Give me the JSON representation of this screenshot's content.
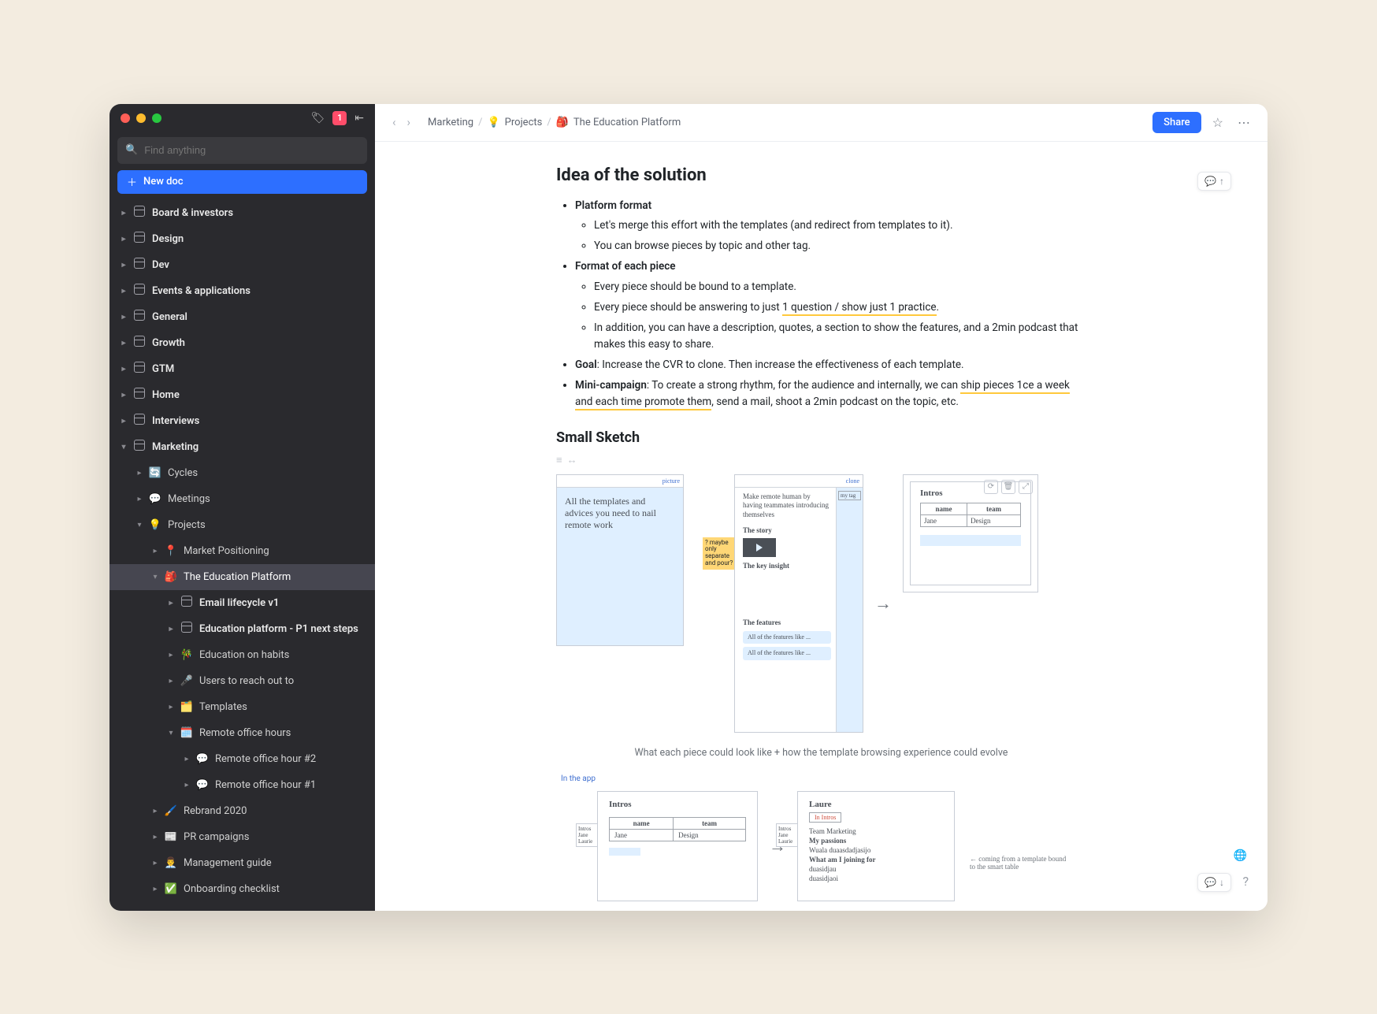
{
  "titlebar": {
    "notif_count": "1"
  },
  "search": {
    "placeholder": "Find anything"
  },
  "new_doc_label": "New doc",
  "sidebar": {
    "items": [
      {
        "label": "Board & investors",
        "indent": 0,
        "icon": "doc",
        "bold": true
      },
      {
        "label": "Design",
        "indent": 0,
        "icon": "doc",
        "bold": true
      },
      {
        "label": "Dev",
        "indent": 0,
        "icon": "doc",
        "bold": true
      },
      {
        "label": "Events & applications",
        "indent": 0,
        "icon": "doc",
        "bold": true
      },
      {
        "label": "General",
        "indent": 0,
        "icon": "doc",
        "bold": true
      },
      {
        "label": "Growth",
        "indent": 0,
        "icon": "doc",
        "bold": true
      },
      {
        "label": "GTM",
        "indent": 0,
        "icon": "doc",
        "bold": true
      },
      {
        "label": "Home",
        "indent": 0,
        "icon": "doc",
        "bold": true
      },
      {
        "label": "Interviews",
        "indent": 0,
        "icon": "doc",
        "bold": true
      },
      {
        "label": "Marketing",
        "indent": 0,
        "icon": "doc",
        "bold": true,
        "open": true
      },
      {
        "label": "Cycles",
        "indent": 1,
        "icon": "🔄"
      },
      {
        "label": "Meetings",
        "indent": 1,
        "icon": "💬"
      },
      {
        "label": "Projects",
        "indent": 1,
        "icon": "💡",
        "open": true
      },
      {
        "label": "Market Positioning",
        "indent": 2,
        "icon": "📍"
      },
      {
        "label": "The Education Platform",
        "indent": 2,
        "icon": "🎒",
        "selected": true,
        "open": true
      },
      {
        "label": "Email lifecycle v1",
        "indent": 3,
        "icon": "doc",
        "bold": true
      },
      {
        "label": "Education platform - P1 next steps",
        "indent": 3,
        "icon": "doc",
        "bold": true
      },
      {
        "label": "Education on habits",
        "indent": 3,
        "icon": "🎋"
      },
      {
        "label": "Users to reach out to",
        "indent": 3,
        "icon": "🎤"
      },
      {
        "label": "Templates",
        "indent": 3,
        "icon": "🗂️"
      },
      {
        "label": "Remote office hours",
        "indent": 3,
        "icon": "🗓️",
        "open": true
      },
      {
        "label": "Remote office hour #2",
        "indent": 4,
        "icon": "💬"
      },
      {
        "label": "Remote office hour #1",
        "indent": 4,
        "icon": "💬"
      },
      {
        "label": "Rebrand 2020",
        "indent": 2,
        "icon": "🖌️"
      },
      {
        "label": "PR campaigns",
        "indent": 2,
        "icon": "📰"
      },
      {
        "label": "Management guide",
        "indent": 2,
        "icon": "👨‍💼"
      },
      {
        "label": "Onboarding checklist",
        "indent": 2,
        "icon": "✅"
      }
    ]
  },
  "breadcrumb": {
    "crumb0": "Marketing",
    "crumb1_icon": "💡",
    "crumb1": "Projects",
    "crumb2_icon": "🎒",
    "crumb2": "The Education Platform"
  },
  "toolbar": {
    "share_label": "Share"
  },
  "doc": {
    "h_idea": "Idea of the solution",
    "b1": "Platform format",
    "b1a": "Let's merge this effort with the templates (and redirect from templates to it).",
    "b1b": "You can browse pieces by topic and other tag.",
    "b2": "Format of each piece",
    "b2a": "Every piece should be bound to a template.",
    "b2b_pre": "Every piece should be answering to just ",
    "b2b_u": "1 question / show just 1 practice",
    "b2b_post": ".",
    "b2c": "In addition, you can have a description, quotes, a section to show the features, and a 2min podcast that makes this easy to share.",
    "b3_label": "Goal",
    "b3_text": ": Increase the CVR to clone. Then increase the effectiveness of each template.",
    "b4_label": "Mini-campaign",
    "b4_pre": ": To create a strong rhythm, for the audience and internally, we can ",
    "b4_u": "ship pieces 1ce a week and each time promote them",
    "b4_post": ", send a mail, shoot a 2min podcast on the topic, etc.",
    "h_sketch": "Small Sketch",
    "sk1_text": "All the templates and advices you need to nail remote work",
    "sk2_t1": "Make remote human by having teammates introducing themselves",
    "sk2_t2": "The story",
    "sk2_t3": "The key insight",
    "sk2_t4": "The features",
    "sk2_f1": "All of the features like ...",
    "sk2_f2": "All of the features like ...",
    "sk2_side": "my tag",
    "stickynote": "? maybe only separate and pour?",
    "sk3_title": "Intros",
    "sk3_h1": "name",
    "sk3_h2": "team",
    "sk3_r1a": "Jane",
    "sk3_r1b": "Design",
    "caption1": "What each piece could look like + how the template browsing experience could evolve",
    "in_app": "In the app",
    "sk4_title": "Intros",
    "sk4_h1": "name",
    "sk4_h2": "team",
    "sk4_r1a": "Jane",
    "sk4_r1b": "Design",
    "sk4_left": "Intros\nJane\nLaurie",
    "sk5_title": "Laure",
    "sk5_badge": "In Intros",
    "sk5_l1": "Team  Marketing",
    "sk5_l2": "My passions",
    "sk5_l3": "Wuala duaasdadjasijo",
    "sk5_l4": "What am I joining for",
    "sk5_l5": "duasidjau",
    "sk5_l6": "duasidjaoi",
    "sk5_left": "Intros\nJane\nLaurie",
    "sk5_annot": "coming from a template bound to the smart table"
  }
}
